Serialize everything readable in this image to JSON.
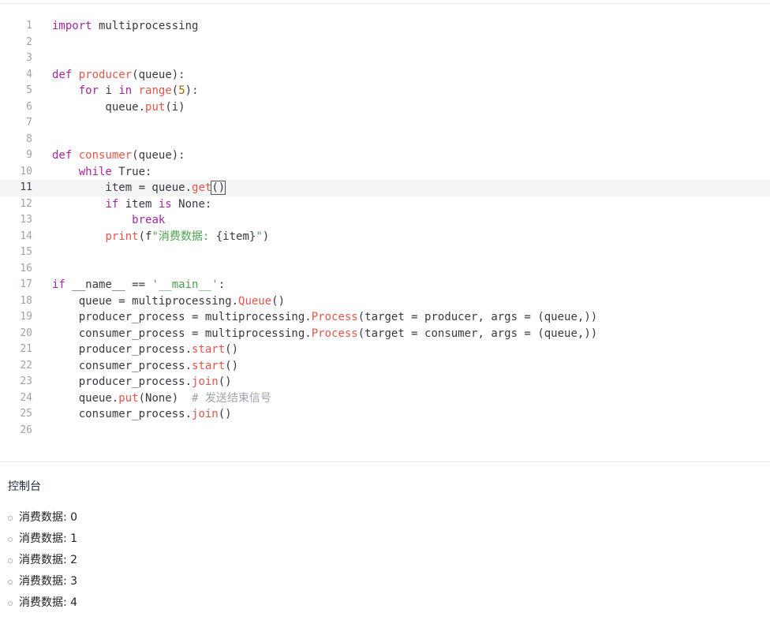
{
  "editor": {
    "active_line": 11,
    "lines": [
      {
        "n": "1",
        "tokens": [
          {
            "t": "import",
            "c": "kw"
          },
          {
            "t": " multiprocessing"
          }
        ]
      },
      {
        "n": "2",
        "tokens": []
      },
      {
        "n": "3",
        "tokens": []
      },
      {
        "n": "4",
        "tokens": [
          {
            "t": "def",
            "c": "kw"
          },
          {
            "t": " "
          },
          {
            "t": "producer",
            "c": "fn"
          },
          {
            "t": "(queue):"
          }
        ]
      },
      {
        "n": "5",
        "tokens": [
          {
            "t": "    "
          },
          {
            "t": "for",
            "c": "kw"
          },
          {
            "t": " i "
          },
          {
            "t": "in",
            "c": "kw"
          },
          {
            "t": " "
          },
          {
            "t": "range",
            "c": "fn"
          },
          {
            "t": "("
          },
          {
            "t": "5",
            "c": "num"
          },
          {
            "t": "):"
          }
        ]
      },
      {
        "n": "6",
        "tokens": [
          {
            "t": "        queue."
          },
          {
            "t": "put",
            "c": "fn"
          },
          {
            "t": "(i)"
          }
        ]
      },
      {
        "n": "7",
        "tokens": []
      },
      {
        "n": "8",
        "tokens": []
      },
      {
        "n": "9",
        "tokens": [
          {
            "t": "def",
            "c": "kw"
          },
          {
            "t": " "
          },
          {
            "t": "consumer",
            "c": "fn"
          },
          {
            "t": "(queue):"
          }
        ]
      },
      {
        "n": "10",
        "tokens": [
          {
            "t": "    "
          },
          {
            "t": "while",
            "c": "kw"
          },
          {
            "t": " True:"
          }
        ]
      },
      {
        "n": "11",
        "tokens": [
          {
            "t": "        item = queue."
          },
          {
            "t": "get",
            "c": "fn"
          },
          {
            "t": "()",
            "c": "cursor-box"
          }
        ]
      },
      {
        "n": "12",
        "tokens": [
          {
            "t": "        "
          },
          {
            "t": "if",
            "c": "kw"
          },
          {
            "t": " item "
          },
          {
            "t": "is",
            "c": "kw"
          },
          {
            "t": " None:"
          }
        ]
      },
      {
        "n": "13",
        "tokens": [
          {
            "t": "            "
          },
          {
            "t": "break",
            "c": "kw"
          }
        ]
      },
      {
        "n": "14",
        "tokens": [
          {
            "t": "        "
          },
          {
            "t": "print",
            "c": "fn"
          },
          {
            "t": "(f"
          },
          {
            "t": "\"消费数据: ",
            "c": "str"
          },
          {
            "t": "{item}"
          },
          {
            "t": "\"",
            "c": "str"
          },
          {
            "t": ")"
          }
        ]
      },
      {
        "n": "15",
        "tokens": []
      },
      {
        "n": "16",
        "tokens": []
      },
      {
        "n": "17",
        "tokens": [
          {
            "t": "if",
            "c": "kw"
          },
          {
            "t": " __name__ == "
          },
          {
            "t": "'__main__'",
            "c": "str"
          },
          {
            "t": ":"
          }
        ]
      },
      {
        "n": "18",
        "tokens": [
          {
            "t": "    queue = multiprocessing."
          },
          {
            "t": "Queue",
            "c": "cls"
          },
          {
            "t": "()"
          }
        ]
      },
      {
        "n": "19",
        "tokens": [
          {
            "t": "    producer_process = multiprocessing."
          },
          {
            "t": "Process",
            "c": "cls"
          },
          {
            "t": "(target = producer, args = (queue,))"
          }
        ]
      },
      {
        "n": "20",
        "tokens": [
          {
            "t": "    consumer_process = multiprocessing."
          },
          {
            "t": "Process",
            "c": "cls"
          },
          {
            "t": "(target = consumer, args = (queue,))"
          }
        ]
      },
      {
        "n": "21",
        "tokens": [
          {
            "t": "    producer_process."
          },
          {
            "t": "start",
            "c": "fn"
          },
          {
            "t": "()"
          }
        ]
      },
      {
        "n": "22",
        "tokens": [
          {
            "t": "    consumer_process."
          },
          {
            "t": "start",
            "c": "fn"
          },
          {
            "t": "()"
          }
        ]
      },
      {
        "n": "23",
        "tokens": [
          {
            "t": "    producer_process."
          },
          {
            "t": "join",
            "c": "fn"
          },
          {
            "t": "()"
          }
        ]
      },
      {
        "n": "24",
        "tokens": [
          {
            "t": "    queue."
          },
          {
            "t": "put",
            "c": "fn"
          },
          {
            "t": "(None)  "
          },
          {
            "t": "# 发送结束信号",
            "c": "cm"
          }
        ]
      },
      {
        "n": "25",
        "tokens": [
          {
            "t": "    consumer_process."
          },
          {
            "t": "join",
            "c": "fn"
          },
          {
            "t": "()"
          }
        ]
      },
      {
        "n": "26",
        "tokens": []
      }
    ]
  },
  "console": {
    "title": "控制台",
    "items": [
      "消费数据: 0",
      "消费数据: 1",
      "消费数据: 2",
      "消费数据: 3",
      "消费数据: 4"
    ]
  }
}
